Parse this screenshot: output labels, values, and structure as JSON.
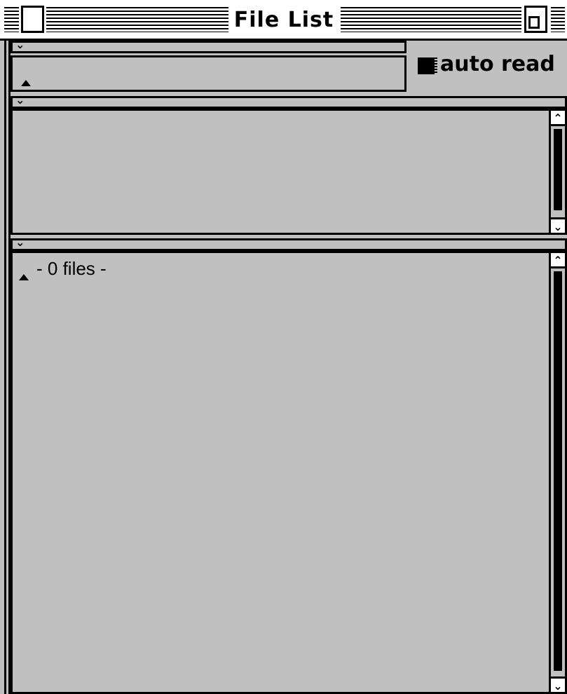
{
  "window": {
    "title": "File List"
  },
  "options": {
    "auto_read_label": "auto read",
    "auto_read_checked": true
  },
  "lists": {
    "file_count_text": "- 0 files -"
  },
  "icons": {
    "close": "close-box-icon",
    "zoom": "zoom-box-icon",
    "collapse": "chevron-down-icon",
    "sort": "triangle-up-icon",
    "scroll_up": "scroll-up-arrow-icon",
    "scroll_down": "scroll-down-arrow-icon"
  },
  "colors": {
    "background": "#c0c0c0",
    "title_bar": "#ffffff",
    "lines": "#000000"
  }
}
